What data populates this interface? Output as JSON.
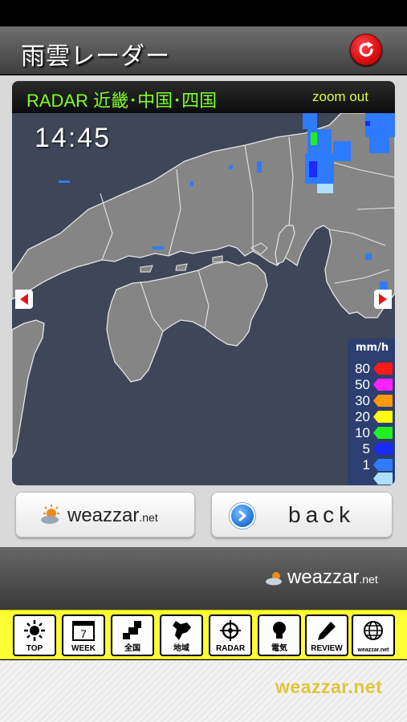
{
  "header": {
    "title": "雨雲レーダー",
    "refresh_icon": "refresh-icon"
  },
  "radar": {
    "title": "RADAR 近畿･中国･四国",
    "zoom_label": "zoom out",
    "time": "14:45",
    "legend": {
      "unit": "mm/h",
      "levels": [
        {
          "value": "80",
          "color": "#ff1a1a"
        },
        {
          "value": "50",
          "color": "#ff22ff"
        },
        {
          "value": "30",
          "color": "#ff9900"
        },
        {
          "value": "20",
          "color": "#ffff00"
        },
        {
          "value": "10",
          "color": "#22ee22"
        },
        {
          "value": "5",
          "color": "#1a2aff"
        },
        {
          "value": "1",
          "color": "#2e7bff"
        },
        {
          "value": "",
          "color": "#aee0ff"
        }
      ]
    },
    "colors": {
      "sea": "#3e4658",
      "land": "#858585",
      "coast": "#e6e6e6"
    }
  },
  "buttons": {
    "weazzar_label": "weazzar",
    "weazzar_suffix": ".net",
    "back_label": "back"
  },
  "footer": {
    "logo_text": "weazzar",
    "logo_suffix": ".net"
  },
  "tabs": [
    {
      "label": "TOP",
      "icon": "sun-icon"
    },
    {
      "label": "WEEK",
      "icon": "calendar-icon",
      "badge": "7"
    },
    {
      "label": "全国",
      "icon": "japan-map-icon"
    },
    {
      "label": "地域",
      "icon": "hokkaido-icon"
    },
    {
      "label": "RADAR",
      "icon": "radar-icon"
    },
    {
      "label": "電気",
      "icon": "bulb-icon"
    },
    {
      "label": "REVIEW",
      "icon": "pencil-icon"
    },
    {
      "label": "weazzar.net",
      "icon": "globe-icon"
    }
  ],
  "bottom_brand": "weazzar.net"
}
